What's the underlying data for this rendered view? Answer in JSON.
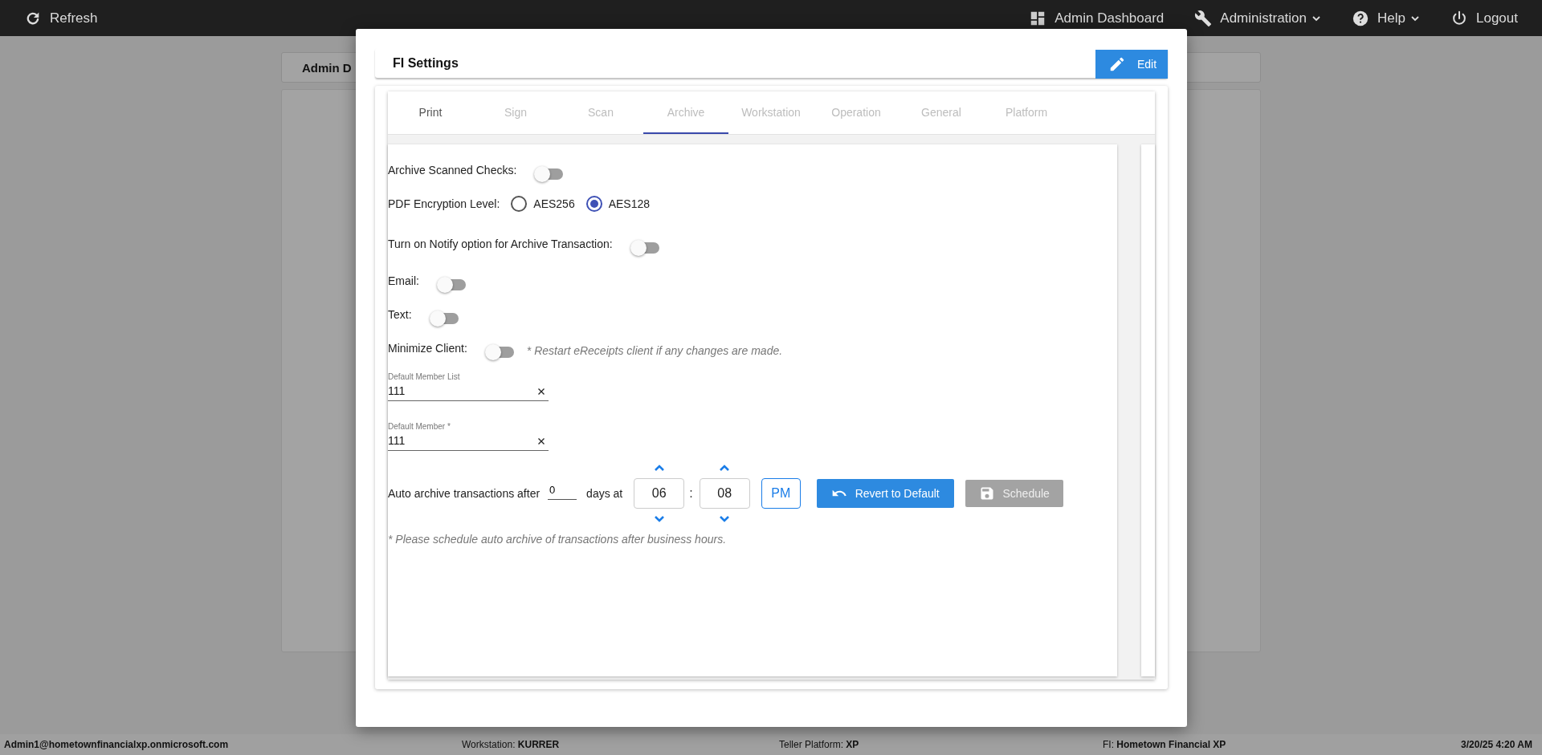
{
  "top_bar": {
    "refresh": "Refresh",
    "menu": [
      {
        "label": "Admin Dashboard",
        "kind": "link"
      },
      {
        "label": "Administration",
        "kind": "dropdown"
      },
      {
        "label": "Help",
        "kind": "dropdown"
      },
      {
        "label": "Logout",
        "kind": "link"
      }
    ]
  },
  "background": {
    "card_title": "Admin D"
  },
  "dialog": {
    "title": "FI Settings",
    "edit_button": "Edit",
    "tabs": [
      {
        "label": "Print",
        "selected": false,
        "disabled": false
      },
      {
        "label": "Sign",
        "selected": false,
        "disabled": true
      },
      {
        "label": "Scan",
        "selected": false,
        "disabled": true
      },
      {
        "label": "Archive",
        "selected": true,
        "disabled": true
      },
      {
        "label": "Workstation",
        "selected": false,
        "disabled": true
      },
      {
        "label": "Operation",
        "selected": false,
        "disabled": true
      },
      {
        "label": "General",
        "selected": false,
        "disabled": true
      },
      {
        "label": "Platform",
        "selected": false,
        "disabled": true
      }
    ],
    "settings": [
      {
        "kind": "toggle",
        "label": "Archive Scanned Checks:",
        "on": false
      },
      {
        "kind": "radio",
        "label": "PDF Encryption Level:",
        "options": [
          {
            "label": "AES256",
            "selected": false
          },
          {
            "label": "AES128",
            "selected": true
          }
        ]
      },
      {
        "kind": "toggle",
        "label": "Turn on Notify option for Archive Transaction:",
        "on": false
      },
      {
        "kind": "toggle",
        "label": "Email:",
        "on": false
      },
      {
        "kind": "toggle",
        "label": "Text:",
        "on": false
      },
      {
        "kind": "toggle",
        "label": "Minimize Client:",
        "on": false,
        "note": "* Restart eReceipts client if any changes are made."
      }
    ],
    "fields": [
      {
        "label": "Default Member List",
        "value": "111"
      },
      {
        "label": "Default Member *",
        "value": "111"
      }
    ],
    "auto_archive": {
      "label": "Auto archive transactions after",
      "days": "0",
      "days_label": "days at",
      "hour": "06",
      "separator": ":",
      "minute": "08",
      "meridiem": "PM"
    },
    "revert_button": "Revert to Default",
    "schedule_button": {
      "label": "Schedule",
      "disabled": true
    },
    "footnote": "* Please schedule auto archive of transactions after business hours."
  },
  "status_bar": [
    {
      "kind": "user",
      "text": "Admin1@hometownfinancialxp.onmicrosoft.com"
    },
    {
      "kind": "info",
      "text": "Workstation: **KURRER**"
    },
    {
      "kind": "info",
      "text": "Teller Platform: **XP**"
    },
    {
      "kind": "info",
      "text": "FI: **Hometown Financial XP**"
    },
    {
      "kind": "time",
      "text": "3/20/25 4:20 AM"
    }
  ]
}
